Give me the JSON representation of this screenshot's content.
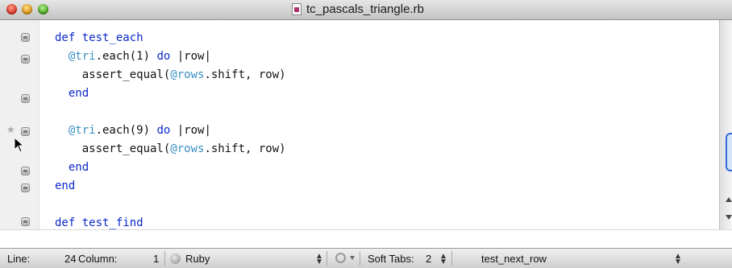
{
  "window": {
    "title": "tc_pascals_triangle.rb",
    "file_icon": "ruby-document-icon"
  },
  "editor": {
    "lines": [
      {
        "indent": "",
        "tokens": [
          {
            "t": "def test_each",
            "c": "kw"
          }
        ]
      },
      {
        "indent": "  ",
        "tokens": [
          {
            "t": "@tri",
            "c": "ivar"
          },
          {
            "t": ".each(1) ",
            "c": ""
          },
          {
            "t": "do",
            "c": "kw"
          },
          {
            "t": " |row|",
            "c": ""
          }
        ]
      },
      {
        "indent": "    ",
        "tokens": [
          {
            "t": "assert_equal(",
            "c": ""
          },
          {
            "t": "@rows",
            "c": "ivar"
          },
          {
            "t": ".shift, row)",
            "c": ""
          }
        ]
      },
      {
        "indent": "  ",
        "tokens": [
          {
            "t": "end",
            "c": "kw"
          }
        ]
      },
      {
        "indent": "",
        "tokens": []
      },
      {
        "indent": "  ",
        "tokens": [
          {
            "t": "@tri",
            "c": "ivar"
          },
          {
            "t": ".each(9) ",
            "c": ""
          },
          {
            "t": "do",
            "c": "kw"
          },
          {
            "t": " |row|",
            "c": ""
          }
        ]
      },
      {
        "indent": "    ",
        "tokens": [
          {
            "t": "assert_equal(",
            "c": ""
          },
          {
            "t": "@rows",
            "c": "ivar"
          },
          {
            "t": ".shift, row)",
            "c": ""
          }
        ]
      },
      {
        "indent": "  ",
        "tokens": [
          {
            "t": "end",
            "c": "kw"
          }
        ]
      },
      {
        "indent": "",
        "tokens": [
          {
            "t": "end",
            "c": "kw"
          }
        ]
      },
      {
        "indent": "",
        "tokens": []
      },
      {
        "indent": "",
        "tokens": [
          {
            "t": "def test_find",
            "c": "kw"
          }
        ]
      }
    ],
    "colors": {
      "keyword": "#0b28c8",
      "instance_variable": "#3b8fc4",
      "text": "#111111"
    }
  },
  "statusbar": {
    "line_label": "Line:",
    "line_value": "24",
    "column_label": "Column:",
    "column_value": "1",
    "language": "Ruby",
    "soft_tabs_label": "Soft Tabs:",
    "soft_tabs_value": "2",
    "symbol": "test_next_row"
  }
}
